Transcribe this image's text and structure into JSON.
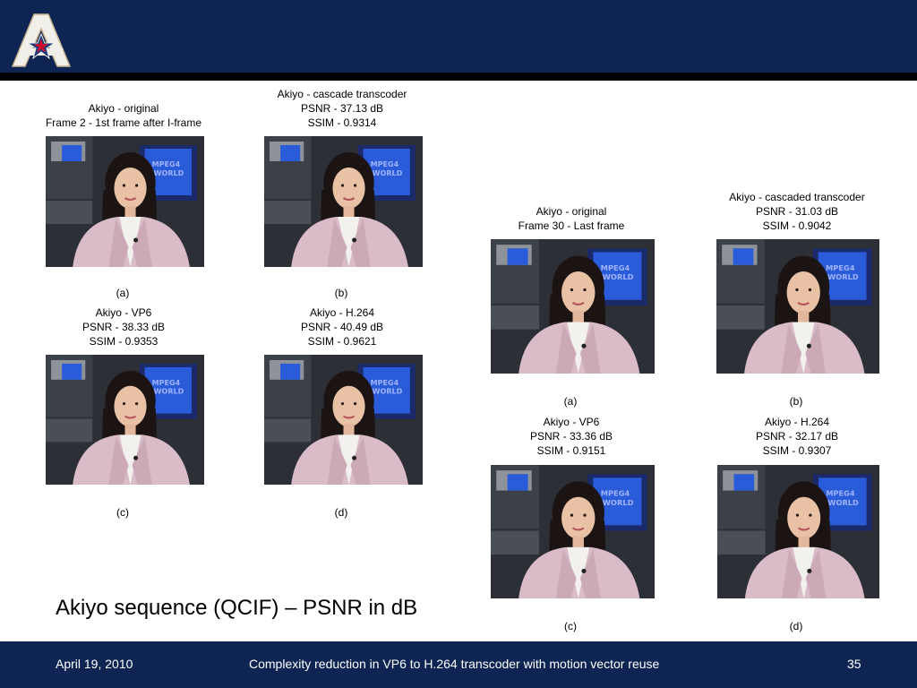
{
  "colors": {
    "header": "#0e2452",
    "accent_blue": "#2a5bd8",
    "jacket": "#d9bcc8"
  },
  "slide": {
    "title": "Akiyo sequence (QCIF) – PSNR in dB",
    "footer": {
      "date": "April 19, 2010",
      "title": "Complexity reduction in VP6 to H.264 transcoder with motion vector  reuse",
      "page": "35"
    }
  },
  "left_group": {
    "original": {
      "line1": "Akiyo - original",
      "line2": "Frame 2 - 1st frame after I-frame"
    },
    "cascade": {
      "line1": "Akiyo - cascade transcoder",
      "line2": "PSNR - 37.13 dB",
      "line3": "SSIM - 0.9314"
    },
    "label_a": "(a)",
    "label_b": "(b)",
    "vp6": {
      "line1": "Akiyo - VP6",
      "line2": "PSNR - 38.33 dB",
      "line3": "SSIM - 0.9353"
    },
    "h264": {
      "line1": "Akiyo - H.264",
      "line2": "PSNR - 40.49 dB",
      "line3": "SSIM - 0.9621"
    },
    "label_c": "(c)",
    "label_d": "(d)"
  },
  "right_group": {
    "original": {
      "line1": "Akiyo - original",
      "line2": "Frame 30 - Last frame"
    },
    "cascade": {
      "line1": "Akiyo - cascaded transcoder",
      "line2": "PSNR - 31.03 dB",
      "line3": "SSIM - 0.9042"
    },
    "label_a": "(a)",
    "label_b": "(b)",
    "vp6": {
      "line1": "Akiyo - VP6",
      "line2": "PSNR - 33.36 dB",
      "line3": "SSIM - 0.9151"
    },
    "h264": {
      "line1": "Akiyo - H.264",
      "line2": "PSNR - 32.17 dB",
      "line3": "SSIM - 0.9307"
    },
    "label_c": "(c)",
    "label_d": "(d)"
  }
}
